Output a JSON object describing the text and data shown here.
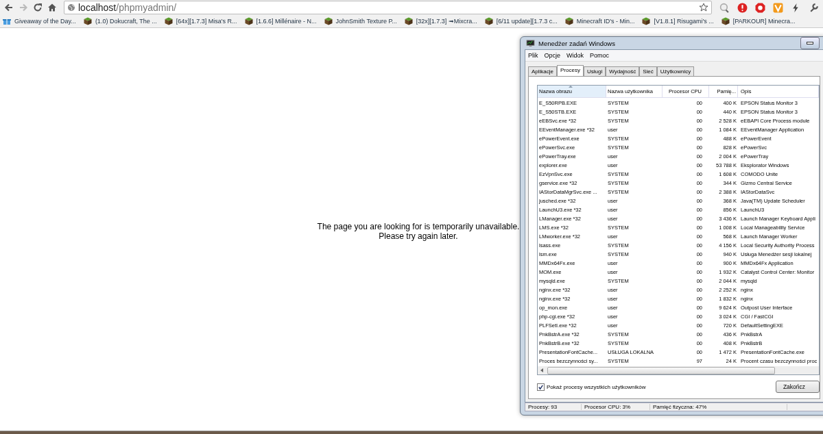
{
  "browser": {
    "url_host": "localhost",
    "url_path": "/phpmyadmin/",
    "bookmarks": [
      {
        "label": "Giveaway of the Day...",
        "kind": "gift"
      },
      {
        "label": "(1.0) Dokucraft, The ...",
        "kind": "block"
      },
      {
        "label": "[64x][1.7.3] Misa's R...",
        "kind": "block"
      },
      {
        "label": "[1.6.6] Millénaire - N...",
        "kind": "block"
      },
      {
        "label": "JohnSmith Texture P...",
        "kind": "block"
      },
      {
        "label": "[32x][1.7.3] ➟Mixcra...",
        "kind": "block"
      },
      {
        "label": "[6/11 update][1.7.3 c...",
        "kind": "block"
      },
      {
        "label": "Minecraft ID's - Min...",
        "kind": "block"
      },
      {
        "label": "[V1.8.1] Risugami's ...",
        "kind": "block"
      },
      {
        "label": "[PARKOUR] Minecra...",
        "kind": "block"
      }
    ]
  },
  "page": {
    "message": [
      "The page you are looking for is temporarily unavailable.",
      "Please try again later."
    ]
  },
  "taskmgr": {
    "title": "Menedżer zadań Windows",
    "menu": [
      "Plik",
      "Opcje",
      "Widok",
      "Pomoc"
    ],
    "tabs": [
      {
        "label": "Aplikacje",
        "selected": false
      },
      {
        "label": "Procesy",
        "selected": true
      },
      {
        "label": "Usługi",
        "selected": false
      },
      {
        "label": "Wydajność",
        "selected": false
      },
      {
        "label": "Sieć",
        "selected": false
      },
      {
        "label": "Użytkownicy",
        "selected": false
      }
    ],
    "columns": [
      {
        "label": "Nazwa obrazu",
        "sorted": true
      },
      {
        "label": "Nazwa użytkownika",
        "sorted": false
      },
      {
        "label": "Procesor CPU",
        "sorted": false
      },
      {
        "label": "Pamię...",
        "sorted": false
      },
      {
        "label": "Opis",
        "sorted": false
      }
    ],
    "rows": [
      [
        "E_S50RPB.EXE",
        "SYSTEM",
        "00",
        "400 K",
        "EPSON Status Monitor 3"
      ],
      [
        "E_S50STB.EXE",
        "SYSTEM",
        "00",
        "440 K",
        "EPSON Status Monitor 3"
      ],
      [
        "eEBSvc.exe *32",
        "SYSTEM",
        "00",
        "2 528 K",
        "eEBAPI Core Process module"
      ],
      [
        "EEventManager.exe *32",
        "user",
        "00",
        "1 084 K",
        "EEventManager Application"
      ],
      [
        "ePowerEvent.exe",
        "SYSTEM",
        "00",
        "488 K",
        "ePowerEvent"
      ],
      [
        "ePowerSvc.exe",
        "SYSTEM",
        "00",
        "828 K",
        "ePowerSvc"
      ],
      [
        "ePowerTray.exe",
        "user",
        "00",
        "2 004 K",
        "ePowerTray"
      ],
      [
        "explorer.exe",
        "user",
        "00",
        "53 788 K",
        "Eksplorator Windows"
      ],
      [
        "EzVpnSvc.exe",
        "SYSTEM",
        "00",
        "1 608 K",
        "COMODO Unite"
      ],
      [
        "gservice.exe *32",
        "SYSTEM",
        "00",
        "344 K",
        "Gizmo Central Service"
      ],
      [
        "IAStorDataMgrSvc.exe ...",
        "SYSTEM",
        "00",
        "2 388 K",
        "IAStorDataSvc"
      ],
      [
        "jusched.exe *32",
        "user",
        "00",
        "368 K",
        "Java(TM) Update Scheduler"
      ],
      [
        "LaunchU3.exe *32",
        "user",
        "00",
        "856 K",
        "LaunchU3"
      ],
      [
        "LManager.exe *32",
        "user",
        "00",
        "3 436 K",
        "Launch Manager Keyboard Appli"
      ],
      [
        "LMS.exe *32",
        "SYSTEM",
        "00",
        "1 008 K",
        "Local Manageability Service"
      ],
      [
        "LMworker.exe *32",
        "user",
        "00",
        "568 K",
        "Launch Manager Worker"
      ],
      [
        "lsass.exe",
        "SYSTEM",
        "00",
        "4 156 K",
        "Local Security Authority Process"
      ],
      [
        "lsm.exe",
        "SYSTEM",
        "00",
        "940 K",
        "Usługa Menedżer sesji lokalnej"
      ],
      [
        "MMDx64Fx.exe",
        "user",
        "00",
        "900 K",
        "MMDx64Fx Application"
      ],
      [
        "MOM.exe",
        "user",
        "00",
        "1 932 K",
        "Catalyst Control Center: Monitor"
      ],
      [
        "mysqld.exe",
        "SYSTEM",
        "00",
        "2 044 K",
        "mysqld"
      ],
      [
        "nginx.exe *32",
        "user",
        "00",
        "2 252 K",
        "nginx"
      ],
      [
        "nginx.exe *32",
        "user",
        "00",
        "1 832 K",
        "nginx"
      ],
      [
        "op_mon.exe",
        "user",
        "00",
        "9 624 K",
        "Outpost User Interface"
      ],
      [
        "php-cgi.exe *32",
        "user",
        "00",
        "3 024 K",
        "CGI / FastCGI"
      ],
      [
        "PLFSetI.exe *32",
        "user",
        "00",
        "720 K",
        "DefaultSettingEXE"
      ],
      [
        "PnkBstrA.exe *32",
        "SYSTEM",
        "00",
        "436 K",
        "PnkBstrA"
      ],
      [
        "PnkBstrB.exe *32",
        "SYSTEM",
        "00",
        "408 K",
        "PnkBstrB"
      ],
      [
        "PresentationFontCache...",
        "USŁUGA LOKALNA",
        "00",
        "1 472 K",
        "PresentationFontCache.exe"
      ],
      [
        "Proces bezczynności sy...",
        "SYSTEM",
        "97",
        "24 K",
        "Procent czasu bezczynności proc"
      ]
    ],
    "show_all": {
      "label": "Pokaż procesy wszystkich użytkowników",
      "checked": true
    },
    "end_button": "Zakończ",
    "status": [
      "Procesy: 93",
      "Procesor CPU: 3%",
      "Pamięć fizyczna: 47%"
    ]
  }
}
